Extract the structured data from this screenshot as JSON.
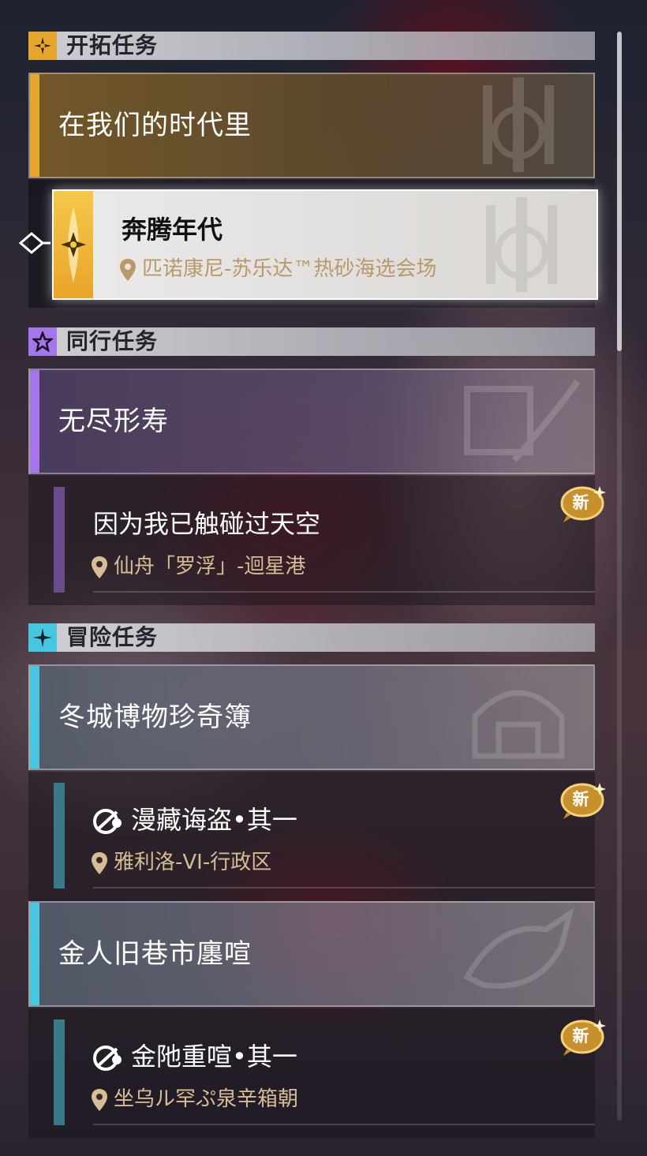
{
  "sections": [
    {
      "title": "开拓任务",
      "group": "在我们的时代里",
      "quest": {
        "title": "奔腾年代",
        "location": "匹诺康尼-苏乐达™热砂海选会场",
        "badge": ""
      }
    },
    {
      "title": "同行任务",
      "group": "无尽形寿",
      "quest": {
        "title": "因为我已触碰过天空",
        "location": "仙舟「罗浮」-迴星港",
        "badge": "新"
      }
    },
    {
      "title": "冒险任务",
      "groups": [
        {
          "group": "冬城博物珍奇簿",
          "quest": {
            "title": "漫藏诲盗•其一",
            "location": "雅利洛-VI-行政区",
            "badge": "新"
          }
        },
        {
          "group": "金人旧巷市廛喧",
          "quest": {
            "title": "金阤重喧•其一",
            "location": "坐乌ル罕ぷ泉辛箱朝",
            "badge": "新"
          }
        }
      ]
    }
  ],
  "colors": {
    "trailblaze": "#e6a62c",
    "companion": "#a575ea",
    "adventure": "#47c6e0",
    "location": "#d6bd95"
  }
}
